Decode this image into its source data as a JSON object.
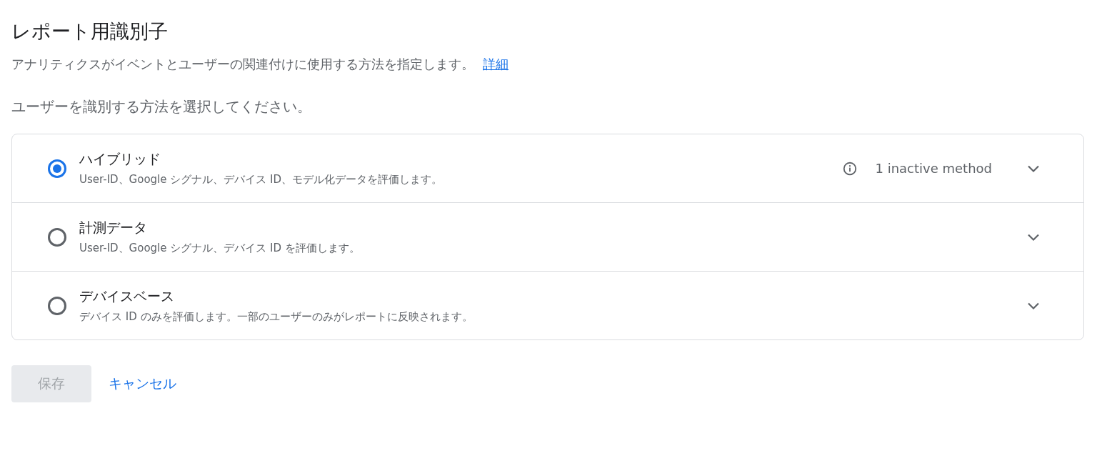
{
  "title": "レポート用識別子",
  "description": {
    "text": "アナリティクスがイベントとユーザーの関連付けに使用する方法を指定します。",
    "link": "詳細"
  },
  "prompt": "ユーザーを識別する方法を選択してください。",
  "options": [
    {
      "label": "ハイブリッド",
      "detail": "User-ID、Google シグナル、デバイス ID、モデル化データを評価します。",
      "note": "1 inactive method",
      "selected": true,
      "expanded": false
    },
    {
      "label": "計測データ",
      "detail": "User-ID、Google シグナル、デバイス ID を評価します。",
      "selected": false,
      "expanded": false
    },
    {
      "label": "デバイスベース",
      "detail": "デバイス ID のみを評価します。一部のユーザーのみがレポートに反映されます。",
      "selected": false,
      "expanded": false
    }
  ],
  "buttons": {
    "save": {
      "label": "保存",
      "disabled": true
    },
    "cancel": {
      "label": "キャンセル"
    }
  }
}
